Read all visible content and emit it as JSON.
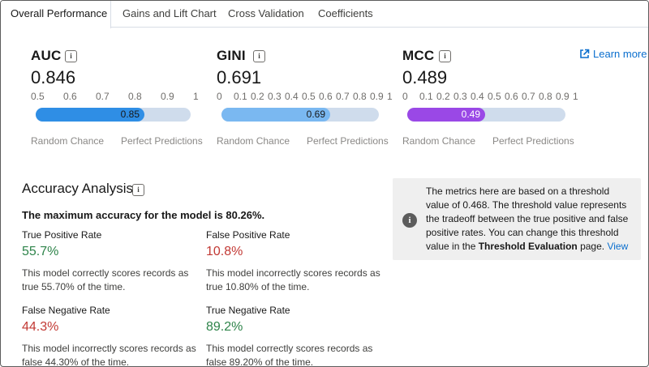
{
  "tabs": [
    {
      "label": "Overall Performance",
      "active": true
    },
    {
      "label": "Gains and Lift Chart",
      "active": false
    },
    {
      "label": "Cross Validation",
      "active": false
    },
    {
      "label": "Coefficients",
      "active": false
    }
  ],
  "learn_more": "Learn more",
  "metrics": [
    {
      "name": "AUC",
      "value": "0.846",
      "ticks": [
        "0.5",
        "0.6",
        "0.7",
        "0.8",
        "0.9",
        "1"
      ],
      "scale_min": 0.5,
      "scale_max": 1,
      "bar_value": 0.85,
      "bar_label": "0.85",
      "bar_color": "#2f8ee5",
      "left_label": "Random Chance",
      "right_label": "Perfect Predictions"
    },
    {
      "name": "GINI",
      "value": "0.691",
      "ticks": [
        "0",
        "0.1",
        "0.2",
        "0.3",
        "0.4",
        "0.5",
        "0.6",
        "0.7",
        "0.8",
        "0.9",
        "1"
      ],
      "scale_min": 0,
      "scale_max": 1,
      "bar_value": 0.69,
      "bar_label": "0.69",
      "bar_color": "#7ab8f1",
      "left_label": "Random Chance",
      "right_label": "Perfect Predictions"
    },
    {
      "name": "MCC",
      "value": "0.489",
      "ticks": [
        "0",
        "0.1",
        "0.2",
        "0.3",
        "0.4",
        "0.5",
        "0.6",
        "0.7",
        "0.8",
        "0.9",
        "1"
      ],
      "scale_min": 0,
      "scale_max": 1,
      "bar_value": 0.49,
      "bar_label": "0.49",
      "bar_color": "#9a48e6",
      "bar_text_color": "#ffffff",
      "left_label": "Random Chance",
      "right_label": "Perfect Predictions"
    }
  ],
  "accuracy": {
    "title": "Accuracy Analysis",
    "summary": "The maximum accuracy for the model is 80.26%.",
    "rates": [
      {
        "label": "True Positive Rate",
        "value": "55.7%",
        "tone": "green",
        "description": "This model correctly scores records as true 55.70% of the time."
      },
      {
        "label": "False Positive Rate",
        "value": "10.8%",
        "tone": "red",
        "description": "This model incorrectly scores records as true 10.80% of the time."
      },
      {
        "label": "False Negative Rate",
        "value": "44.3%",
        "tone": "red",
        "description": "This model incorrectly scores records as false 44.30% of the time."
      },
      {
        "label": "True Negative Rate",
        "value": "89.2%",
        "tone": "green",
        "description": "This model correctly scores records as false 89.20% of the time."
      }
    ]
  },
  "note": {
    "text_before": "The metrics here are based on a threshold value of 0.468. The threshold value represents the tradeoff between the true positive and false positive rates. You can change this threshold value in the ",
    "bold": "Threshold Evaluation",
    "text_after": " page. ",
    "link": "View"
  },
  "colors": {
    "accent": "#0b6fce",
    "positive": "#2e844a",
    "negative": "#c23934",
    "track": "#cfdcec"
  }
}
